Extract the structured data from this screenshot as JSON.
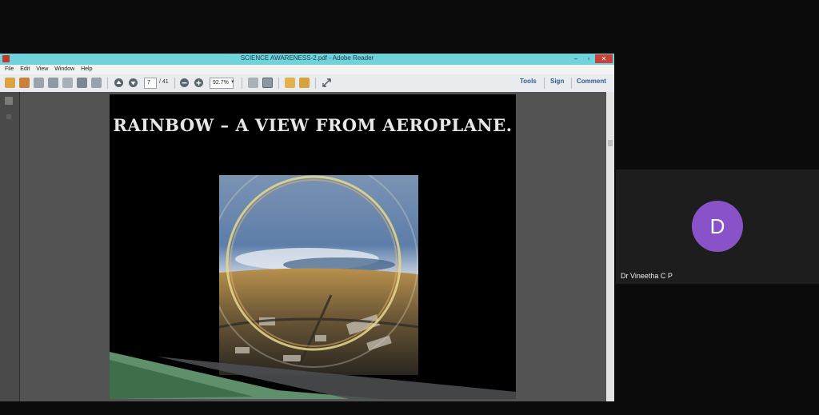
{
  "window": {
    "title": "SCIENCE AWARENESS-2.pdf - Adobe Reader",
    "minimize": "–",
    "maximize": "▫",
    "close": "✕"
  },
  "menu": [
    "File",
    "Edit",
    "View",
    "Window",
    "Help"
  ],
  "toolbar": {
    "page_current": "7",
    "page_total": "/ 41",
    "zoom": "92.7%",
    "tools": "Tools",
    "sign": "Sign",
    "comment": "Comment"
  },
  "slide": {
    "title": "RAINBOW – A VIEW FROM AEROPLANE."
  },
  "participant": {
    "initial": "D",
    "name": "Dr Vineetha C P",
    "avatar_color": "#8a52c8"
  }
}
